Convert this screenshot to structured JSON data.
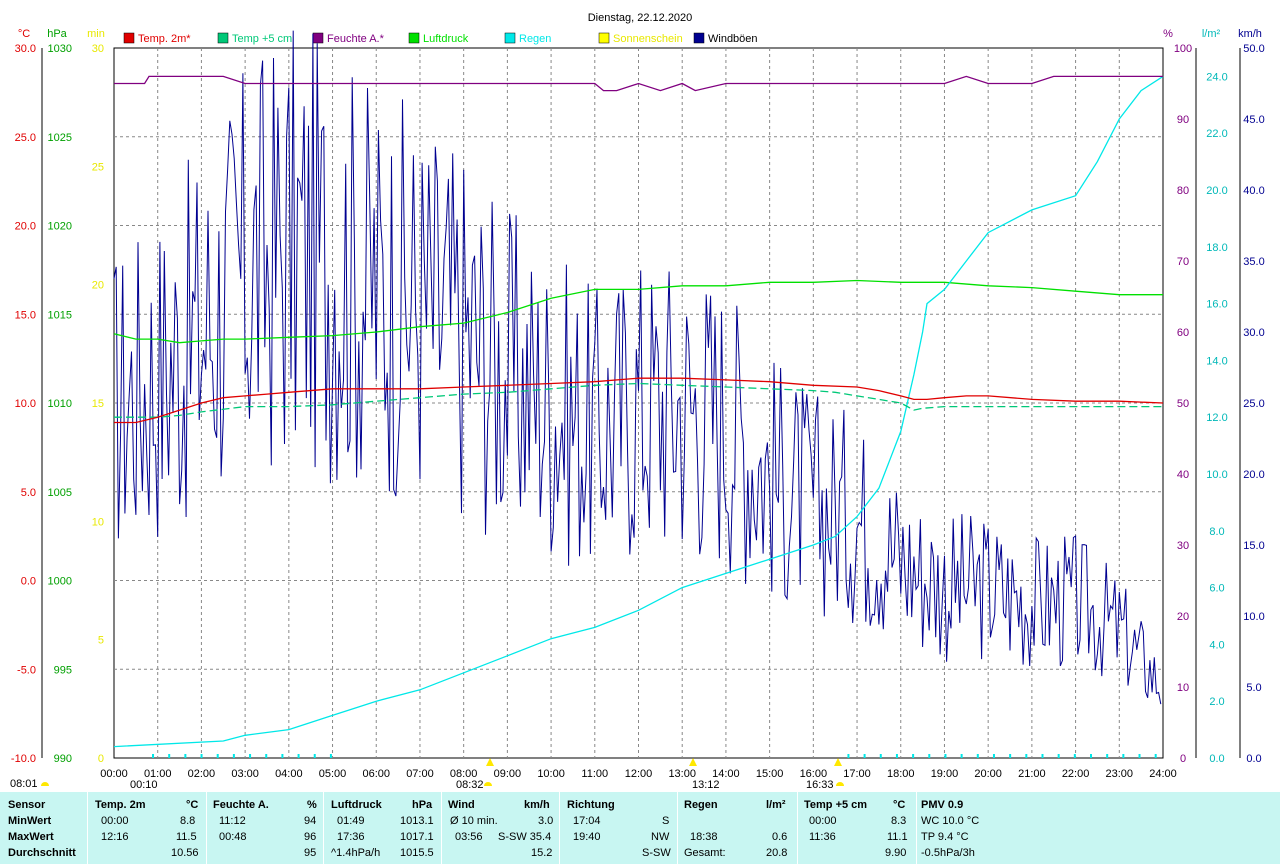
{
  "title": "Dienstag, 22.12.2020",
  "axes": {
    "temp": {
      "unit": "°C",
      "ticks": [
        "30.0",
        "25.0",
        "20.0",
        "15.0",
        "10.0",
        "5.0",
        "0.0",
        "-5.0",
        "-10.0"
      ],
      "min": -10,
      "max": 30
    },
    "pressure": {
      "unit": "hPa",
      "ticks": [
        "1030",
        "1025",
        "1020",
        "1015",
        "1010",
        "1005",
        "1000",
        "995",
        "990"
      ],
      "min": 990,
      "max": 1030
    },
    "sun": {
      "unit": "min",
      "ticks": [
        "30",
        "25",
        "20",
        "15",
        "10",
        "5",
        "0"
      ],
      "min": 0,
      "max": 30
    },
    "humidity": {
      "unit": "%",
      "ticks": [
        "100",
        "90",
        "80",
        "70",
        "60",
        "50",
        "40",
        "30",
        "20",
        "10",
        "0"
      ],
      "min": 0,
      "max": 100
    },
    "rain": {
      "unit": "l/m²",
      "ticks": [
        "24.0",
        "22.0",
        "20.0",
        "18.0",
        "16.0",
        "14.0",
        "12.0",
        "10.0",
        "8.0",
        "6.0",
        "4.0",
        "2.0",
        "0.0"
      ],
      "min": 0,
      "max": 25
    },
    "wind": {
      "unit": "km/h",
      "ticks": [
        "50.0",
        "45.0",
        "40.0",
        "35.0",
        "30.0",
        "25.0",
        "20.0",
        "15.0",
        "10.0",
        "5.0",
        "0.0"
      ],
      "min": 0,
      "max": 50
    },
    "x_ticks": [
      "00:00",
      "01:00",
      "02:00",
      "03:00",
      "04:00",
      "05:00",
      "06:00",
      "07:00",
      "08:00",
      "09:00",
      "10:00",
      "11:00",
      "12:00",
      "13:00",
      "14:00",
      "15:00",
      "16:00",
      "17:00",
      "18:00",
      "19:00",
      "20:00",
      "21:00",
      "22:00",
      "23:00",
      "24:00"
    ]
  },
  "legend": [
    {
      "label": "Temp. 2m*",
      "color": "#e00000"
    },
    {
      "label": "Temp +5 cm",
      "color": "#00c878"
    },
    {
      "label": "Feuchte A.*",
      "color": "#800080"
    },
    {
      "label": "Luftdruck",
      "color": "#00e000"
    },
    {
      "label": "Regen",
      "color": "#00e8e8"
    },
    {
      "label": "Sonnenschein",
      "color": "#ffff00"
    },
    {
      "label": "Windböen",
      "color": "#000090"
    }
  ],
  "colors": {
    "temp2m": "#e00000",
    "temp5cm": "#00c878",
    "humidity": "#800080",
    "pressure": "#00e000",
    "rain": "#00e8e8",
    "sun": "#ffe800",
    "wind": "#000090",
    "sunlabel": "#e8e800"
  },
  "annotations": {
    "min_temp_marker": "00:10",
    "sunrise": "08:01",
    "sun_a": "08:32",
    "sun_noon": "13:12",
    "sun_b": "16:33"
  },
  "chart_data": {
    "type": "line",
    "title": "Dienstag, 22.12.2020",
    "x_unit": "hours",
    "xlim": [
      0,
      24
    ],
    "series": [
      {
        "name": "Temp. 2m*",
        "axis": "temp",
        "x": [
          0,
          0.5,
          1,
          1.5,
          2,
          2.5,
          3,
          3.5,
          4,
          5,
          6,
          7,
          8,
          9,
          10,
          11,
          12,
          13,
          14,
          15,
          16,
          17,
          17.5,
          18,
          18.3,
          18.6,
          19,
          19.5,
          20,
          21,
          22,
          23,
          24
        ],
        "values": [
          8.9,
          8.9,
          9.2,
          9.6,
          10.0,
          10.3,
          10.4,
          10.5,
          10.6,
          10.8,
          10.8,
          10.8,
          10.9,
          11.0,
          11.1,
          11.2,
          11.4,
          11.4,
          11.3,
          11.2,
          11.0,
          10.9,
          10.7,
          10.4,
          10.2,
          10.2,
          10.3,
          10.4,
          10.4,
          10.2,
          10.1,
          10.1,
          10.0
        ]
      },
      {
        "name": "Temp +5 cm",
        "axis": "temp",
        "x": [
          0,
          1,
          1.5,
          2,
          3,
          4,
          5,
          6,
          7,
          8,
          9,
          10,
          11,
          12,
          13,
          14,
          15,
          16,
          16.5,
          17,
          17.5,
          18,
          18.3,
          18.5,
          19,
          20,
          21,
          22,
          23,
          24
        ],
        "values": [
          9.2,
          9.2,
          9.3,
          9.5,
          9.8,
          9.8,
          9.9,
          10.1,
          10.3,
          10.5,
          10.6,
          10.8,
          11.0,
          11.1,
          11.0,
          10.9,
          10.8,
          10.7,
          10.6,
          10.4,
          10.2,
          10.0,
          9.6,
          9.7,
          9.8,
          9.8,
          9.8,
          9.8,
          9.8,
          9.8
        ]
      },
      {
        "name": "Feuchte A.*",
        "axis": "humidity",
        "x": [
          0,
          0.7,
          0.8,
          1,
          1.5,
          2,
          2.5,
          3,
          4,
          5,
          6,
          7,
          8,
          9,
          10,
          11,
          11.2,
          11.5,
          12,
          12.5,
          13,
          13.3,
          14,
          15,
          16,
          17,
          18,
          19,
          19.5,
          20,
          21,
          21.5,
          22,
          23,
          24
        ],
        "values": [
          95,
          95,
          96,
          96,
          96,
          96,
          96,
          95,
          95,
          95,
          95,
          95,
          95,
          95,
          95,
          95,
          94,
          94,
          95,
          94,
          95,
          94,
          95,
          95,
          95,
          95,
          95,
          95,
          96,
          95,
          95,
          96,
          96,
          96,
          96
        ]
      },
      {
        "name": "Luftdruck",
        "axis": "pressure",
        "x": [
          0,
          0.5,
          1,
          1.5,
          2,
          2.5,
          3,
          4,
          5,
          6,
          7,
          8,
          9,
          9.5,
          10,
          11,
          12,
          13,
          14,
          15,
          16,
          17,
          18,
          19,
          20,
          21,
          22,
          23,
          24
        ],
        "values": [
          1013.9,
          1013.6,
          1013.6,
          1013.4,
          1013.5,
          1013.6,
          1013.6,
          1013.7,
          1013.8,
          1014.0,
          1014.3,
          1014.5,
          1015.1,
          1015.5,
          1015.9,
          1016.4,
          1016.4,
          1016.6,
          1016.6,
          1016.8,
          1016.8,
          1016.9,
          1016.8,
          1016.8,
          1016.6,
          1016.5,
          1016.3,
          1016.1,
          1016.1
        ]
      },
      {
        "name": "Regen",
        "axis": "rain",
        "x": [
          0,
          2.5,
          3,
          4,
          5,
          6,
          7,
          8,
          9,
          10,
          11,
          12,
          13,
          14,
          15,
          16,
          16.5,
          17,
          17.5,
          18,
          18.3,
          18.5,
          18.6,
          19,
          19.5,
          20,
          21,
          22,
          22.5,
          23,
          23.5,
          24
        ],
        "values": [
          0.4,
          0.6,
          0.8,
          1.0,
          1.5,
          2.0,
          2.4,
          3.0,
          3.6,
          4.2,
          4.6,
          5.2,
          6.0,
          6.5,
          7.0,
          7.5,
          7.8,
          8.5,
          9.5,
          11.5,
          13.5,
          15.0,
          16.0,
          16.5,
          17.5,
          18.5,
          19.3,
          19.8,
          21.0,
          22.5,
          23.5,
          24.0
        ]
      },
      {
        "name": "Windböen",
        "axis": "wind",
        "x": [
          0,
          1,
          2,
          3,
          4,
          5,
          6,
          7,
          8,
          9,
          10,
          11,
          12,
          13,
          14,
          15,
          16,
          17,
          18,
          19,
          20,
          21,
          22,
          23,
          24
        ],
        "values": [
          25,
          27,
          30,
          34,
          36,
          35,
          33,
          32,
          30,
          27,
          25,
          23,
          25,
          25,
          24,
          20,
          18,
          17,
          14,
          12,
          12,
          11,
          11,
          9,
          5
        ]
      }
    ],
    "sun_minutes": 0
  },
  "table": {
    "headers": [
      {
        "label": "Sensor",
        "unit": ""
      },
      {
        "label": "Temp. 2m",
        "unit": "°C"
      },
      {
        "label": "Feuchte A.",
        "unit": "%"
      },
      {
        "label": "Luftdruck",
        "unit": "hPa"
      },
      {
        "label": "Wind",
        "unit": "km/h"
      },
      {
        "label": "Richtung",
        "unit": ""
      },
      {
        "label": "Regen",
        "unit": "l/m²"
      },
      {
        "label": "Temp +5 cm",
        "unit": "°C"
      },
      {
        "label": "PMV 0.9",
        "unit": ""
      }
    ],
    "row_labels": [
      "MinWert",
      "MaxWert",
      "Durchschnitt"
    ],
    "temp2m": [
      [
        "00:00",
        "8.8"
      ],
      [
        "12:16",
        "11.5"
      ],
      [
        "",
        "10.56"
      ]
    ],
    "humidity": [
      [
        "11:12",
        "94"
      ],
      [
        "00:48",
        "96"
      ],
      [
        "",
        "95"
      ]
    ],
    "pressure": [
      [
        "01:49",
        "1013.1"
      ],
      [
        "17:36",
        "1017.1"
      ],
      [
        "^1.4hPa/h",
        "1015.5"
      ]
    ],
    "wind": [
      [
        "Ø 10 min.",
        "3.0"
      ],
      [
        "03:56",
        "S-SW 35.4"
      ],
      [
        "",
        "15.2"
      ]
    ],
    "direction": [
      [
        "17:04",
        "S"
      ],
      [
        "19:40",
        "NW"
      ],
      [
        "",
        "S-SW"
      ]
    ],
    "rain": [
      [
        "",
        ""
      ],
      [
        "18:38",
        "0.6"
      ],
      [
        "Gesamt:",
        "20.8"
      ]
    ],
    "temp5cm": [
      [
        "00:00",
        "8.3"
      ],
      [
        "11:36",
        "11.1"
      ],
      [
        "",
        "9.90"
      ]
    ],
    "pmv": [
      "WC 10.0 °C",
      "TP 9.4 °C",
      "-0.5hPa/3h"
    ]
  }
}
